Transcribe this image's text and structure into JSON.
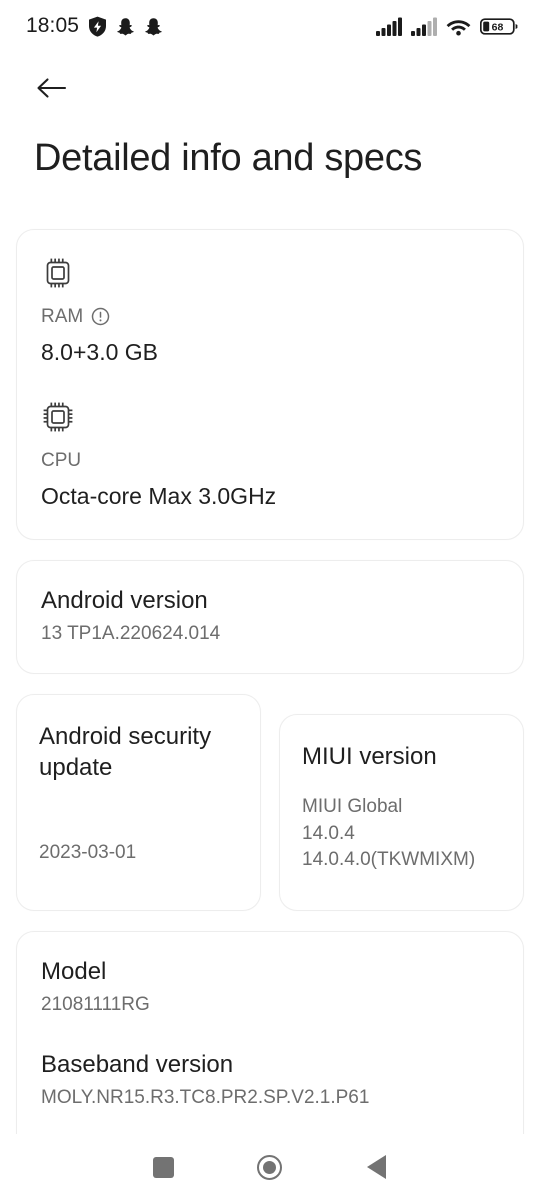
{
  "status_bar": {
    "time": "18:05",
    "left_icons": [
      "shield-bolt-icon",
      "snapchat-icon",
      "snapchat-icon"
    ],
    "right_icons": [
      "signal-bars-icon",
      "signal-bars-icon",
      "wifi-icon",
      "battery-icon"
    ],
    "battery_level": "68"
  },
  "app_bar": {
    "back_icon": "arrow-left-icon",
    "title": "Detailed info and specs"
  },
  "specs_card": {
    "ram": {
      "icon": "memory-chip-icon",
      "label": "RAM",
      "info_icon": "info-circle-icon",
      "value": "8.0+3.0 GB"
    },
    "cpu": {
      "icon": "cpu-chip-icon",
      "label": "CPU",
      "value": "Octa-core Max 3.0GHz"
    }
  },
  "android_version": {
    "title": "Android version",
    "value": "13 TP1A.220624.014"
  },
  "security_update": {
    "title": "Android security update",
    "value": "2023-03-01"
  },
  "miui_version": {
    "title": "MIUI version",
    "line1": "MIUI Global",
    "line2": "14.0.4",
    "line3": "14.0.4.0(TKWMIXM)"
  },
  "model": {
    "title": "Model",
    "value": "21081111RG"
  },
  "baseband": {
    "title": "Baseband version",
    "value": "MOLY.NR15.R3.TC8.PR2.SP.V2.1.P61"
  },
  "nav_bar": {
    "recents": "recents-square-icon",
    "home": "home-circle-icon",
    "back": "back-triangle-icon"
  },
  "colors": {
    "background": "#ffffff",
    "card_border": "#ededed",
    "text_primary": "#1f1f1f",
    "text_secondary": "#6d6d6d",
    "nav_icon": "#737373"
  }
}
